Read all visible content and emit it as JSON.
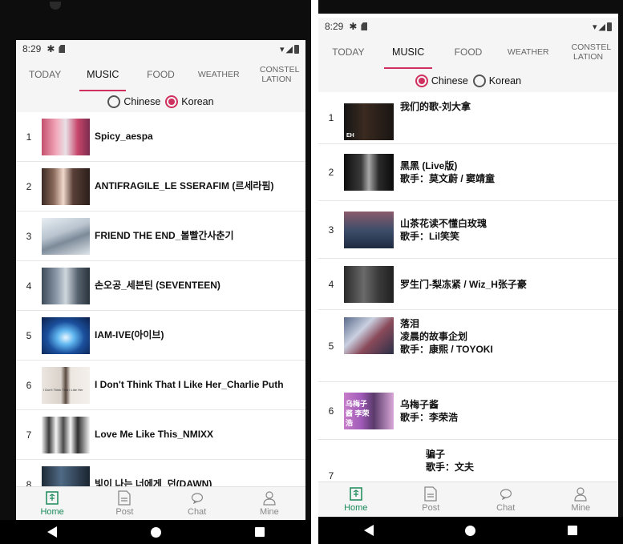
{
  "colors": {
    "accent": "#d0305f",
    "nav_active": "#1a8a5a",
    "system_bar": "#000000"
  },
  "left": {
    "status": {
      "time": "8:29",
      "gear_icon": "gear-icon",
      "sd_icon": "sd-card-icon",
      "signal": "▾◢"
    },
    "tabs": [
      {
        "label": "TODAY"
      },
      {
        "label": "MUSIC"
      },
      {
        "label": "FOOD"
      },
      {
        "label": "WEATHER"
      },
      {
        "label": "CONSTEL LATION"
      }
    ],
    "active_tab": "MUSIC",
    "radio": {
      "option1": "Chinese",
      "option2": "Korean",
      "selected": "Korean"
    },
    "songs": [
      {
        "rank": "1",
        "title": "Spicy_aespa"
      },
      {
        "rank": "2",
        "title": "ANTIFRAGILE_LE SSERAFIM (르세라핌)"
      },
      {
        "rank": "3",
        "title": "FRIEND THE END_볼빨간사춘기"
      },
      {
        "rank": "4",
        "title": "손오공_세븐틴 (SEVENTEEN)"
      },
      {
        "rank": "5",
        "title": "IAM-IVE(아이브)"
      },
      {
        "rank": "6",
        "title": "I Don't Think That I Like Her_Charlie Puth",
        "thumb_text": "I Don't Think That I Like Her"
      },
      {
        "rank": "7",
        "title": "Love Me Like This_NMIXX"
      },
      {
        "rank": "8",
        "title": "빛이 나는 너에게_던(DAWN)"
      }
    ],
    "nav": [
      {
        "label": "Home",
        "icon": "home-icon"
      },
      {
        "label": "Post",
        "icon": "post-icon"
      },
      {
        "label": "Chat",
        "icon": "chat-icon"
      },
      {
        "label": "Mine",
        "icon": "user-icon"
      }
    ]
  },
  "right": {
    "status": {
      "time": "8:29",
      "gear_icon": "gear-icon",
      "sd_icon": "sd-card-icon",
      "signal": "▾◢"
    },
    "tabs": [
      {
        "label": "TODAY"
      },
      {
        "label": "MUSIC"
      },
      {
        "label": "FOOD"
      },
      {
        "label": "WEATHER"
      },
      {
        "label": "CONSTEL LATION"
      }
    ],
    "active_tab": "MUSIC",
    "radio": {
      "option1": "Chinese",
      "option2": "Korean",
      "selected": "Chinese"
    },
    "songs": [
      {
        "rank": "1",
        "line1": "我们的歌-刘大拿",
        "thumb_text": "EH"
      },
      {
        "rank": "2",
        "line1": "黑黑 (Live版)",
        "line2": "歌手：莫文蔚 / 窦靖童"
      },
      {
        "rank": "3",
        "line1": "山茶花读不懂白玫瑰",
        "line2": "歌手：Lil笑笑"
      },
      {
        "rank": "4",
        "line1": "罗生门-梨冻紧 / Wiz_H张子豪"
      },
      {
        "rank": "5",
        "line1": "落泪",
        "line2": "凌晨的故事企划",
        "line3": "歌手：康熙 / TOYOKI"
      },
      {
        "rank": "6",
        "line1": "乌梅子酱",
        "line2": "歌手：李荣浩",
        "thumb_text": "乌梅子酱 李荣浩"
      },
      {
        "rank": "7",
        "line1": "骗子",
        "line2": "歌手：文夫"
      }
    ],
    "nav": [
      {
        "label": "Home",
        "icon": "home-icon"
      },
      {
        "label": "Post",
        "icon": "post-icon"
      },
      {
        "label": "Chat",
        "icon": "chat-icon"
      },
      {
        "label": "Mine",
        "icon": "user-icon"
      }
    ]
  }
}
